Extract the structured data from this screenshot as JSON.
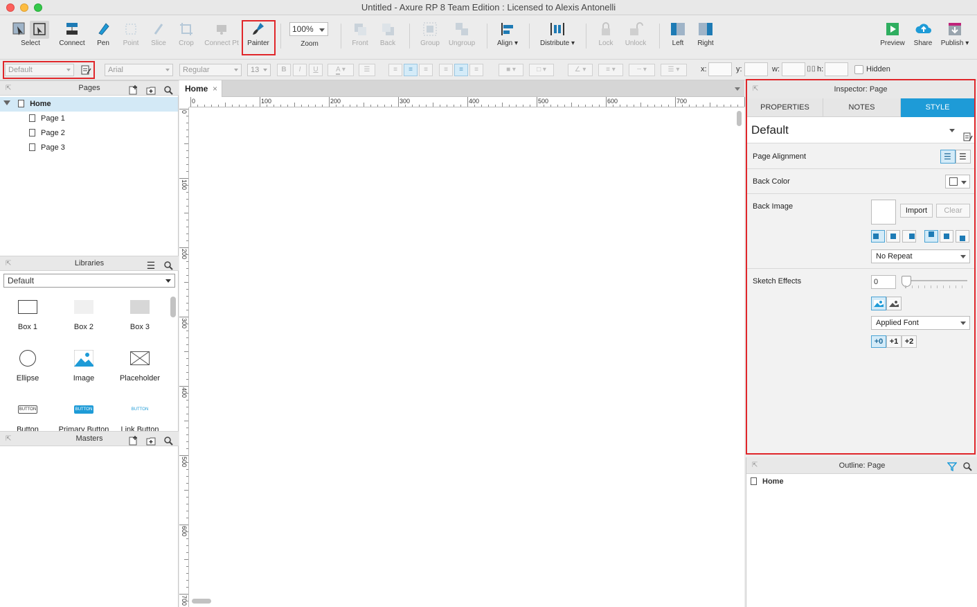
{
  "window": {
    "title": "Untitled - Axure RP 8 Team Edition : Licensed to Alexis Antonelli"
  },
  "toolbar": {
    "select": "Select",
    "connect": "Connect",
    "pen": "Pen",
    "point": "Point",
    "slice": "Slice",
    "crop": "Crop",
    "connect_pt": "Connect Pt",
    "painter": "Painter",
    "zoom_value": "100%",
    "zoom": "Zoom",
    "front": "Front",
    "back": "Back",
    "group": "Group",
    "ungroup": "Ungroup",
    "align": "Align ▾",
    "distribute": "Distribute ▾",
    "lock": "Lock",
    "unlock": "Unlock",
    "left": "Left",
    "right": "Right",
    "preview": "Preview",
    "share": "Share",
    "publish": "Publish ▾"
  },
  "format": {
    "style": "Default",
    "font": "Arial",
    "weight": "Regular",
    "size": "13",
    "bold": "B",
    "italic": "I",
    "underline": "U",
    "x_label": "x:",
    "y_label": "y:",
    "w_label": "w:",
    "h_label": "h:",
    "hidden": "Hidden"
  },
  "pages": {
    "title": "Pages",
    "items": [
      {
        "label": "Home"
      },
      {
        "label": "Page 1"
      },
      {
        "label": "Page 2"
      },
      {
        "label": "Page 3"
      }
    ]
  },
  "libraries": {
    "title": "Libraries",
    "selected": "Default",
    "widgets": [
      "Box 1",
      "Box 2",
      "Box 3",
      "Ellipse",
      "Image",
      "Placeholder",
      "Button",
      "Primary Button",
      "Link Button"
    ],
    "button_text": "BUTTON"
  },
  "masters": {
    "title": "Masters"
  },
  "canvas": {
    "tab": "Home",
    "close": "×",
    "hruler": [
      "0",
      "100",
      "200",
      "300",
      "400",
      "500",
      "600",
      "700"
    ],
    "vruler": [
      "0",
      "100",
      "200",
      "300",
      "400",
      "500",
      "600",
      "700"
    ]
  },
  "inspector": {
    "title": "Inspector: Page",
    "tabs": [
      "PROPERTIES",
      "NOTES",
      "STYLE"
    ],
    "style_name": "Default",
    "page_alignment": "Page Alignment",
    "back_color": "Back Color",
    "back_image": "Back Image",
    "import": "Import",
    "clear": "Clear",
    "repeat": "No Repeat",
    "sketch_effects": "Sketch Effects",
    "sketch_value": "0",
    "font": "Applied Font",
    "font_steps": [
      "+0",
      "+1",
      "+2"
    ]
  },
  "outline": {
    "title": "Outline: Page",
    "root": "Home"
  },
  "colors": {
    "accent": "#1e9bd7",
    "highlight": "#e0262a",
    "selection": "#d3e9f6"
  }
}
